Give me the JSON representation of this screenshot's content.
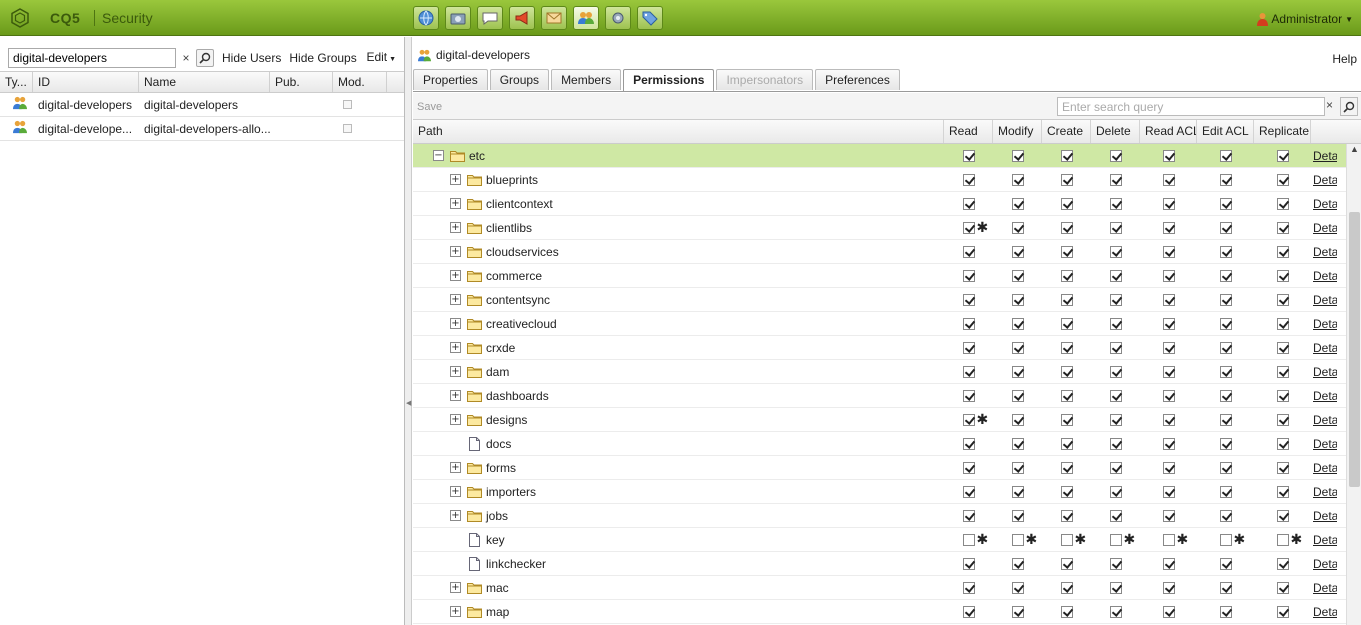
{
  "app": {
    "brand": "CQ5",
    "section": "Security",
    "user": "Administrator"
  },
  "topbar_icons": [
    "websites-icon",
    "digital-assets-icon",
    "community-icon",
    "campaigns-icon",
    "inbox-icon",
    "users-icon",
    "tools-icon",
    "tagging-icon"
  ],
  "left": {
    "search_value": "digital-developers",
    "clear": "×",
    "hide_users": "Hide Users",
    "hide_groups": "Hide Groups",
    "edit": "Edit",
    "columns": [
      "Ty...",
      "ID",
      "Name",
      "Pub.",
      "Mod."
    ],
    "rows": [
      {
        "id": "digital-developers",
        "name": "digital-developers"
      },
      {
        "id": "digital-develope...",
        "name": "digital-developers-allo..."
      }
    ]
  },
  "right": {
    "title": "digital-developers",
    "help": "Help",
    "tabs": [
      "Properties",
      "Groups",
      "Members",
      "Permissions",
      "Impersonators",
      "Preferences"
    ],
    "active_tab": "Permissions",
    "disabled_tab": "Impersonators",
    "save": "Save",
    "search_placeholder": "Enter search query",
    "columns": [
      "Path",
      "Read",
      "Modify",
      "Create",
      "Delete",
      "Read ACL",
      "Edit ACL",
      "Replicate"
    ],
    "details_label": "Detai",
    "rows": [
      {
        "name": "etc",
        "level": 0,
        "type": "folder",
        "expanded": true,
        "selected": true,
        "perms": [
          1,
          1,
          1,
          1,
          1,
          1,
          1
        ],
        "stars": [
          0,
          0,
          0,
          0,
          0,
          0,
          0
        ]
      },
      {
        "name": "blueprints",
        "level": 1,
        "type": "folder",
        "perms": [
          1,
          1,
          1,
          1,
          1,
          1,
          1
        ],
        "stars": [
          0,
          0,
          0,
          0,
          0,
          0,
          0
        ]
      },
      {
        "name": "clientcontext",
        "level": 1,
        "type": "folder",
        "perms": [
          1,
          1,
          1,
          1,
          1,
          1,
          1
        ],
        "stars": [
          0,
          0,
          0,
          0,
          0,
          0,
          0
        ]
      },
      {
        "name": "clientlibs",
        "level": 1,
        "type": "folder",
        "perms": [
          1,
          1,
          1,
          1,
          1,
          1,
          1
        ],
        "stars": [
          1,
          0,
          0,
          0,
          0,
          0,
          0
        ]
      },
      {
        "name": "cloudservices",
        "level": 1,
        "type": "folder",
        "perms": [
          1,
          1,
          1,
          1,
          1,
          1,
          1
        ],
        "stars": [
          0,
          0,
          0,
          0,
          0,
          0,
          0
        ]
      },
      {
        "name": "commerce",
        "level": 1,
        "type": "folder",
        "perms": [
          1,
          1,
          1,
          1,
          1,
          1,
          1
        ],
        "stars": [
          0,
          0,
          0,
          0,
          0,
          0,
          0
        ]
      },
      {
        "name": "contentsync",
        "level": 1,
        "type": "folder",
        "perms": [
          1,
          1,
          1,
          1,
          1,
          1,
          1
        ],
        "stars": [
          0,
          0,
          0,
          0,
          0,
          0,
          0
        ]
      },
      {
        "name": "creativecloud",
        "level": 1,
        "type": "folder",
        "perms": [
          1,
          1,
          1,
          1,
          1,
          1,
          1
        ],
        "stars": [
          0,
          0,
          0,
          0,
          0,
          0,
          0
        ]
      },
      {
        "name": "crxde",
        "level": 1,
        "type": "folder",
        "perms": [
          1,
          1,
          1,
          1,
          1,
          1,
          1
        ],
        "stars": [
          0,
          0,
          0,
          0,
          0,
          0,
          0
        ]
      },
      {
        "name": "dam",
        "level": 1,
        "type": "folder",
        "perms": [
          1,
          1,
          1,
          1,
          1,
          1,
          1
        ],
        "stars": [
          0,
          0,
          0,
          0,
          0,
          0,
          0
        ]
      },
      {
        "name": "dashboards",
        "level": 1,
        "type": "folder",
        "perms": [
          1,
          1,
          1,
          1,
          1,
          1,
          1
        ],
        "stars": [
          0,
          0,
          0,
          0,
          0,
          0,
          0
        ]
      },
      {
        "name": "designs",
        "level": 1,
        "type": "folder",
        "perms": [
          1,
          1,
          1,
          1,
          1,
          1,
          1
        ],
        "stars": [
          1,
          0,
          0,
          0,
          0,
          0,
          0
        ]
      },
      {
        "name": "docs",
        "level": 1,
        "type": "file",
        "perms": [
          1,
          1,
          1,
          1,
          1,
          1,
          1
        ],
        "stars": [
          0,
          0,
          0,
          0,
          0,
          0,
          0
        ]
      },
      {
        "name": "forms",
        "level": 1,
        "type": "folder",
        "perms": [
          1,
          1,
          1,
          1,
          1,
          1,
          1
        ],
        "stars": [
          0,
          0,
          0,
          0,
          0,
          0,
          0
        ]
      },
      {
        "name": "importers",
        "level": 1,
        "type": "folder",
        "perms": [
          1,
          1,
          1,
          1,
          1,
          1,
          1
        ],
        "stars": [
          0,
          0,
          0,
          0,
          0,
          0,
          0
        ]
      },
      {
        "name": "jobs",
        "level": 1,
        "type": "folder",
        "perms": [
          1,
          1,
          1,
          1,
          1,
          1,
          1
        ],
        "stars": [
          0,
          0,
          0,
          0,
          0,
          0,
          0
        ]
      },
      {
        "name": "key",
        "level": 1,
        "type": "file",
        "perms": [
          0,
          0,
          0,
          0,
          0,
          0,
          0
        ],
        "stars": [
          1,
          1,
          1,
          1,
          1,
          1,
          1
        ]
      },
      {
        "name": "linkchecker",
        "level": 1,
        "type": "file",
        "perms": [
          1,
          1,
          1,
          1,
          1,
          1,
          1
        ],
        "stars": [
          0,
          0,
          0,
          0,
          0,
          0,
          0
        ]
      },
      {
        "name": "mac",
        "level": 1,
        "type": "folder",
        "perms": [
          1,
          1,
          1,
          1,
          1,
          1,
          1
        ],
        "stars": [
          0,
          0,
          0,
          0,
          0,
          0,
          0
        ]
      },
      {
        "name": "map",
        "level": 1,
        "type": "folder",
        "perms": [
          1,
          1,
          1,
          1,
          1,
          1,
          1
        ],
        "stars": [
          0,
          0,
          0,
          0,
          0,
          0,
          0
        ]
      }
    ]
  },
  "colors": {
    "topbar": "#8bbd30",
    "selected_row": "#cfe8a4"
  }
}
